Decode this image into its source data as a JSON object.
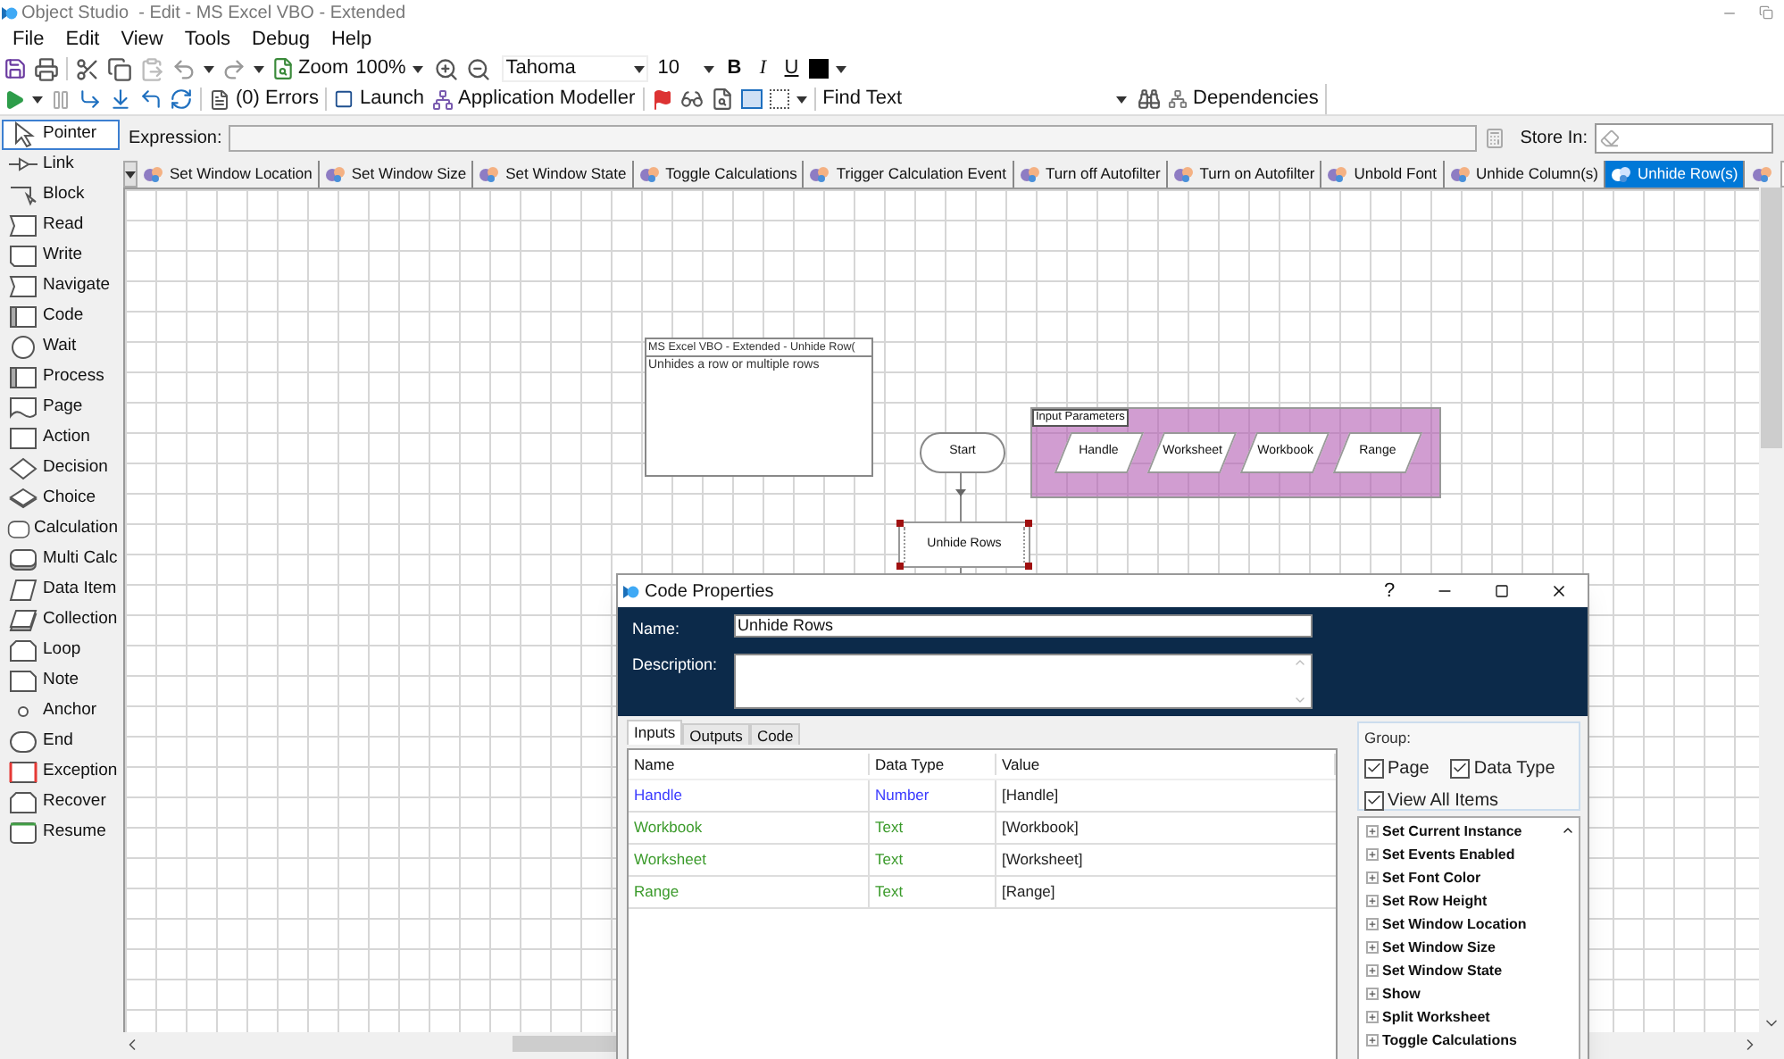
{
  "window": {
    "title": "Object Studio  - Edit - MS Excel VBO - Extended"
  },
  "menu": [
    "File",
    "Edit",
    "View",
    "Tools",
    "Debug",
    "Help"
  ],
  "toolbar": {
    "zoom_label": "Zoom",
    "zoom_value": "100%",
    "font": "Tahoma",
    "font_size": "10",
    "bold": "B",
    "italic": "I",
    "underline": "U"
  },
  "toolbar2": {
    "errors": "(0) Errors",
    "launch": "Launch",
    "app_modeller": "Application Modeller",
    "find_label": "Find Text",
    "dependencies": "Dependencies"
  },
  "palette": [
    {
      "label": "Pointer",
      "kind": "pointer",
      "selected": true
    },
    {
      "label": "Link",
      "kind": "link",
      "selected": false
    },
    {
      "label": "Block",
      "kind": "block",
      "selected": false
    },
    {
      "label": "Read",
      "kind": "read",
      "selected": false
    },
    {
      "label": "Write",
      "kind": "write",
      "selected": false
    },
    {
      "label": "Navigate",
      "kind": "read",
      "selected": false
    },
    {
      "label": "Code",
      "kind": "code",
      "selected": false
    },
    {
      "label": "Wait",
      "kind": "circle",
      "selected": false
    },
    {
      "label": "Process",
      "kind": "code",
      "selected": false
    },
    {
      "label": "Page",
      "kind": "page",
      "selected": false
    },
    {
      "label": "Action",
      "kind": "rect",
      "selected": false
    },
    {
      "label": "Decision",
      "kind": "diamond",
      "selected": false
    },
    {
      "label": "Choice",
      "kind": "choice",
      "selected": false
    },
    {
      "label": "Calculation",
      "kind": "rounded",
      "selected": false
    },
    {
      "label": "Multi Calc",
      "kind": "multi",
      "selected": false
    },
    {
      "label": "Data Item",
      "kind": "parallelogram",
      "selected": false
    },
    {
      "label": "Collection",
      "kind": "collection",
      "selected": false
    },
    {
      "label": "Loop",
      "kind": "loop",
      "selected": false
    },
    {
      "label": "Note",
      "kind": "note",
      "selected": false
    },
    {
      "label": "Anchor",
      "kind": "dot",
      "selected": false
    },
    {
      "label": "End",
      "kind": "terminal",
      "selected": false
    },
    {
      "label": "Exception",
      "kind": "exception",
      "selected": false
    },
    {
      "label": "Recover",
      "kind": "recover",
      "selected": false
    },
    {
      "label": "Resume",
      "kind": "resume",
      "selected": false
    }
  ],
  "expression": {
    "label": "Expression:",
    "store_label": "Store In:"
  },
  "page_tabs": [
    {
      "label": "Set Window Location",
      "selected": false
    },
    {
      "label": "Set Window Size",
      "selected": false
    },
    {
      "label": "Set Window State",
      "selected": false
    },
    {
      "label": "Toggle Calculations",
      "selected": false
    },
    {
      "label": "Trigger Calculation Event",
      "selected": false
    },
    {
      "label": "Turn off Autofilter",
      "selected": false
    },
    {
      "label": "Turn on Autofilter",
      "selected": false
    },
    {
      "label": "Unbold Font",
      "selected": false
    },
    {
      "label": "Unhide Column(s)",
      "selected": false
    },
    {
      "label": "Unhide Row(s)",
      "selected": true
    }
  ],
  "canvas": {
    "info_box": {
      "title": "MS Excel VBO - Extended - Unhide Row(",
      "description": "Unhides a row or multiple rows"
    },
    "start": "Start",
    "code_stage": "Unhide Rows",
    "input_parameters": {
      "title": "Input Parameters",
      "items": [
        "Handle",
        "Worksheet",
        "Workbook",
        "Range"
      ]
    }
  },
  "dialog": {
    "title": "Code Properties",
    "help": "?",
    "name_label": "Name:",
    "name_value": "Unhide Rows",
    "description_label": "Description:",
    "tabs": [
      {
        "label": "Inputs",
        "selected": true
      },
      {
        "label": "Outputs",
        "selected": false
      },
      {
        "label": "Code",
        "selected": false
      }
    ],
    "columns": [
      "Name",
      "Data Type",
      "Value"
    ],
    "rows": [
      {
        "name": "Handle",
        "data_type": "Number",
        "value": "[Handle]",
        "color": "#3b3bff"
      },
      {
        "name": "Workbook",
        "data_type": "Text",
        "value": "[Workbook]",
        "color": "#3a9a2a"
      },
      {
        "name": "Worksheet",
        "data_type": "Text",
        "value": "[Worksheet]",
        "color": "#3a9a2a"
      },
      {
        "name": "Range",
        "data_type": "Text",
        "value": "[Range]",
        "color": "#3a9a2a"
      }
    ],
    "group_label": "Group:",
    "checks": [
      {
        "label": "Page",
        "checked": true
      },
      {
        "label": "Data Type",
        "checked": true
      },
      {
        "label": "View All Items",
        "checked": true
      }
    ],
    "tree": [
      "Set Current Instance",
      "Set Events Enabled",
      "Set Font Color",
      "Set Row Height",
      "Set Window Location",
      "Set Window Size",
      "Set Window State",
      "Show",
      "Split Worksheet",
      "Toggle Calculations"
    ]
  }
}
